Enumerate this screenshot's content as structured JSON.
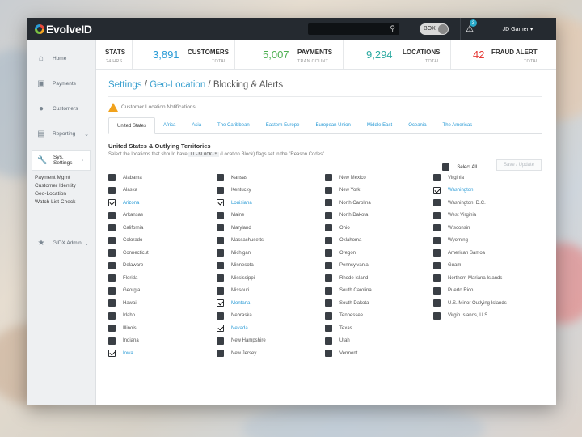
{
  "brand": {
    "name": "EvolveID"
  },
  "topbar": {
    "search_icon": "search-icon",
    "box_label": "BOX",
    "alert_count": "3",
    "user_name": "JD Garner"
  },
  "sidebar": {
    "items": [
      {
        "label": "Home",
        "icon": "home-icon"
      },
      {
        "label": "Payments",
        "icon": "payments-icon"
      },
      {
        "label": "Customers",
        "icon": "customers-icon"
      },
      {
        "label": "Reporting",
        "icon": "chart-icon"
      },
      {
        "label": "Sys. Settings",
        "icon": "wrench-icon"
      },
      {
        "label": "GIDX Admin",
        "icon": "star-icon"
      }
    ],
    "sub_items": [
      "Payment Mgmt",
      "Customer Identity",
      "Geo-Location",
      "Watch List Check"
    ]
  },
  "stats": [
    {
      "label": "STATS",
      "sub": "24 HRS",
      "value": ""
    },
    {
      "label": "CUSTOMERS",
      "sub": "TOTAL",
      "value": "3,891"
    },
    {
      "label": "PAYMENTS",
      "sub": "TRAN COUNT",
      "value": "5,007"
    },
    {
      "label": "LOCATIONS",
      "sub": "TOTAL",
      "value": "9,294"
    },
    {
      "label": "FRAUD ALERT",
      "sub": "TOTAL",
      "value": "42"
    }
  ],
  "breadcrumb": {
    "part1": "Settings",
    "part2": "Geo-Location",
    "part3": "Blocking & Alerts",
    "sep": "/"
  },
  "notification": "Customer Location Notifications",
  "tabs": [
    "United States",
    "Africa",
    "Asia",
    "The Caribbean",
    "Eastern Europe",
    "European Union",
    "Middle East",
    "Oceania",
    "The Americas"
  ],
  "section": {
    "title": "United States & Outlying Territories",
    "desc_before": "Select the locations that should have",
    "code": "LL-BLOCK-*",
    "desc_after": "(Location Block) flags set in the \"Reason Codes\"."
  },
  "select_all_label": "Select All",
  "save_label": "Save / Update",
  "colors": {
    "accent": "#2a9bd6",
    "teal": "#2aa9c8",
    "green": "#4caf50",
    "red": "#e53935",
    "warning": "#f1a21c"
  },
  "locations": [
    [
      {
        "name": "Alabama",
        "checked": false
      },
      {
        "name": "Alaska",
        "checked": false
      },
      {
        "name": "Arizona",
        "checked": true
      },
      {
        "name": "Arkansas",
        "checked": false
      },
      {
        "name": "California",
        "checked": false
      },
      {
        "name": "Colorado",
        "checked": false
      },
      {
        "name": "Connecticut",
        "checked": false
      },
      {
        "name": "Delaware",
        "checked": false
      },
      {
        "name": "Florida",
        "checked": false
      },
      {
        "name": "Georgia",
        "checked": false
      },
      {
        "name": "Hawaii",
        "checked": false
      },
      {
        "name": "Idaho",
        "checked": false
      },
      {
        "name": "Illinois",
        "checked": false
      },
      {
        "name": "Indiana",
        "checked": false
      },
      {
        "name": "Iowa",
        "checked": true
      }
    ],
    [
      {
        "name": "Kansas",
        "checked": false
      },
      {
        "name": "Kentucky",
        "checked": false
      },
      {
        "name": "Louisiana",
        "checked": true
      },
      {
        "name": "Maine",
        "checked": false
      },
      {
        "name": "Maryland",
        "checked": false
      },
      {
        "name": "Massachusetts",
        "checked": false
      },
      {
        "name": "Michigan",
        "checked": false
      },
      {
        "name": "Minnesota",
        "checked": false
      },
      {
        "name": "Mississippi",
        "checked": false
      },
      {
        "name": "Missouri",
        "checked": false
      },
      {
        "name": "Montana",
        "checked": true
      },
      {
        "name": "Nebraska",
        "checked": false
      },
      {
        "name": "Nevada",
        "checked": true
      },
      {
        "name": "New Hampshire",
        "checked": false
      },
      {
        "name": "New Jersey",
        "checked": false
      }
    ],
    [
      {
        "name": "New Mexico",
        "checked": false
      },
      {
        "name": "New York",
        "checked": false
      },
      {
        "name": "North Carolina",
        "checked": false
      },
      {
        "name": "North Dakota",
        "checked": false
      },
      {
        "name": "Ohio",
        "checked": false
      },
      {
        "name": "Oklahoma",
        "checked": false
      },
      {
        "name": "Oregon",
        "checked": false
      },
      {
        "name": "Pennsylvania",
        "checked": false
      },
      {
        "name": "Rhode Island",
        "checked": false
      },
      {
        "name": "South Carolina",
        "checked": false
      },
      {
        "name": "South Dakota",
        "checked": false
      },
      {
        "name": "Tennessee",
        "checked": false
      },
      {
        "name": "Texas",
        "checked": false
      },
      {
        "name": "Utah",
        "checked": false
      },
      {
        "name": "Vermont",
        "checked": false
      }
    ],
    [
      {
        "name": "Virginia",
        "checked": false
      },
      {
        "name": "Washington",
        "checked": true
      },
      {
        "name": "Washington, D.C.",
        "checked": false
      },
      {
        "name": "West Virginia",
        "checked": false
      },
      {
        "name": "Wisconsin",
        "checked": false
      },
      {
        "name": "Wyoming",
        "checked": false
      },
      {
        "name": "American Samoa",
        "checked": false
      },
      {
        "name": "Guam",
        "checked": false
      },
      {
        "name": "Northern Mariana Islands",
        "checked": false
      },
      {
        "name": "Puerto Rico",
        "checked": false
      },
      {
        "name": "U.S. Minor Outlying Islands",
        "checked": false
      },
      {
        "name": "Virgin Islands, U.S.",
        "checked": false
      }
    ]
  ]
}
